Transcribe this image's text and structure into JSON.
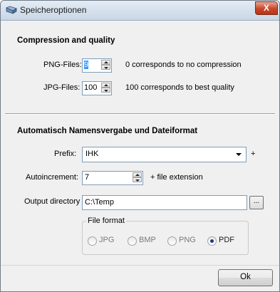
{
  "window": {
    "title": "Speicheroptionen",
    "close_label": "X"
  },
  "compression": {
    "heading": "Compression and quality",
    "png_label": "PNG-Files:",
    "png_value": "9",
    "png_hint": "0 corresponds to no compression",
    "jpg_label": "JPG-Files:",
    "jpg_value": "100",
    "jpg_hint": "100 corresponds to best quality"
  },
  "naming": {
    "heading": "Automatisch Namensvergabe  und Dateiformat",
    "prefix_label": "Prefix:",
    "prefix_value": "IHK",
    "prefix_plus": "+",
    "autoincrement_label": "Autoincrement:",
    "autoincrement_value": "7",
    "autoincrement_plus": "+  file extension",
    "output_label": "Output directory",
    "output_value": "C:\\Temp",
    "browse_label": "..."
  },
  "file_format": {
    "legend": "File format",
    "options": [
      {
        "label": "JPG",
        "checked": false
      },
      {
        "label": "BMP",
        "checked": false
      },
      {
        "label": "PNG",
        "checked": false
      },
      {
        "label": "PDF",
        "checked": true
      }
    ]
  },
  "footer": {
    "ok_label": "Ok"
  },
  "colors": {
    "accent": "#3399ff",
    "close": "#c7462b",
    "border": "#7f9db9"
  }
}
